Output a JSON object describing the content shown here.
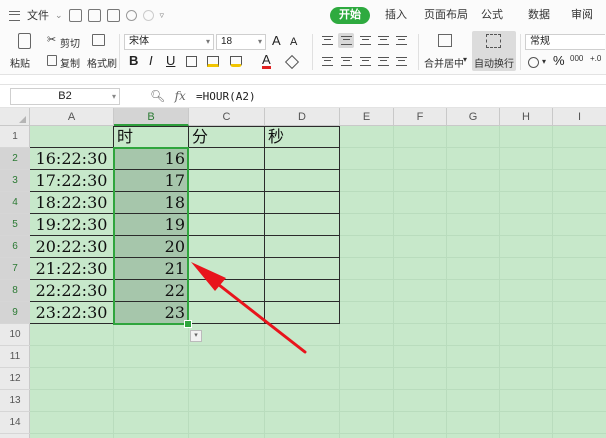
{
  "topbar": {
    "menu_label": "文件",
    "tabs": [
      "开始",
      "插入",
      "页面布局",
      "公式",
      "数据",
      "审阅"
    ]
  },
  "ribbon": {
    "cut": "剪切",
    "paste": "粘贴",
    "copy": "复制",
    "format_painter": "格式刷",
    "font_name": "宋体",
    "font_size": "18",
    "merge_center": "合并居中",
    "wrap_text": "自动换行",
    "number_format": "常规",
    "percent": "%",
    "thousands": "000"
  },
  "formula_bar": {
    "name_box": "B2",
    "fx_label": "fx",
    "formula": "=HOUR(A2)"
  },
  "sheet": {
    "columns": [
      "A",
      "B",
      "C",
      "D",
      "E",
      "F",
      "G",
      "H",
      "I"
    ],
    "selected_column": "B",
    "rows": [
      "1",
      "2",
      "3",
      "4",
      "5",
      "6",
      "7",
      "8",
      "9",
      "10",
      "11",
      "12",
      "13",
      "14"
    ],
    "headers": {
      "b": "时",
      "c": "分",
      "d": "秒"
    },
    "data": [
      {
        "time": "16:22:30",
        "hour": "16"
      },
      {
        "time": "17:22:30",
        "hour": "17"
      },
      {
        "time": "18:22:30",
        "hour": "18"
      },
      {
        "time": "19:22:30",
        "hour": "19"
      },
      {
        "time": "20:22:30",
        "hour": "20"
      },
      {
        "time": "21:22:30",
        "hour": "21"
      },
      {
        "time": "22:22:30",
        "hour": "22"
      },
      {
        "time": "23:22:30",
        "hour": "23"
      }
    ]
  },
  "colors": {
    "accent": "#2eaa3f",
    "sheet_bg": "#c7e8ca",
    "selection": "#a6c6ab",
    "arrow": "#e8141c"
  }
}
